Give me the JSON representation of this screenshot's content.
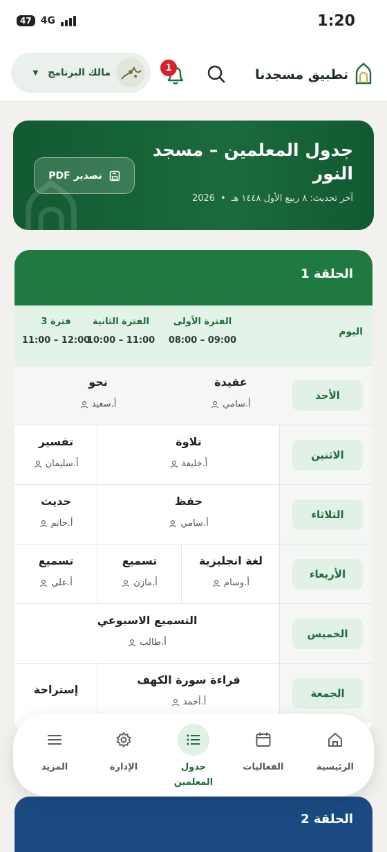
{
  "status_bar": {
    "battery": "47",
    "network": "4G",
    "time": "1:20"
  },
  "app_bar": {
    "app_name": "تطبيق مسجدنا",
    "notification_count": "1",
    "user_name": "مالك البرنامج",
    "icons": [
      "mosque-logo-icon",
      "search-icon",
      "bell-icon",
      "avatar",
      "caret-down-icon"
    ]
  },
  "hero": {
    "title": "جدول المعلمين – مسجد النور",
    "year": "2026",
    "dot": "•",
    "updated": "آخر تحديث: ٨ ربيع الأول ١٤٤٨ هـ",
    "export_label": "تصدير PDF",
    "colors": {
      "bg": "#1b6a3d"
    }
  },
  "circle1": {
    "title": "الحلقة 1",
    "header": {
      "day_label": "اليوم",
      "periods": [
        {
          "name": "الفترة الأولى",
          "time": "08:00 – 09:00"
        },
        {
          "name": "الفترة الثانية",
          "time": "10:00 – 11:00"
        },
        {
          "name": "فترة 3",
          "time": "11:00 – 12:00"
        }
      ]
    },
    "rows": [
      {
        "day": "الأحد",
        "slots": [
          {
            "subject": "عقيدة",
            "teacher": "أ.سامي"
          },
          {
            "subject": "نحو",
            "teacher": "أ.سعيد"
          }
        ]
      },
      {
        "day": "الاثنين",
        "slots": [
          {
            "subject": "تلاوة",
            "teacher": "أ.خليفة"
          },
          {
            "subject": "تفسير",
            "teacher": "أ.سليمان"
          }
        ]
      },
      {
        "day": "الثلاثاء",
        "slots": [
          {
            "subject": "حفظ",
            "teacher": "أ.سامي"
          },
          {
            "subject": "حديث",
            "teacher": "أ.حاتم"
          }
        ]
      },
      {
        "day": "الأربعاء",
        "slots": [
          {
            "subject": "لغة انجليزية",
            "teacher": "أ.وسام"
          },
          {
            "subject": "تسميع",
            "teacher": "أ.مازن"
          },
          {
            "subject": "تسميع",
            "teacher": "أ.علي"
          }
        ]
      },
      {
        "day": "الخميس",
        "slots": [
          {
            "subject": "التسميع الاسبوعي",
            "teacher": "أ.طالب"
          }
        ]
      },
      {
        "day": "الجمعة",
        "slots": [
          {
            "subject": "قراءة سورة الكهف",
            "teacher": "أ.أحمد"
          },
          {
            "subject": "إستراحة",
            "teacher": ""
          }
        ]
      }
    ]
  },
  "circle2": {
    "title": "الحلقة 2",
    "color": "#1b4a82"
  },
  "bottom_nav": {
    "items": [
      {
        "label": "الرئيسية",
        "icon": "home-icon"
      },
      {
        "label": "الفعاليات",
        "icon": "calendar-icon"
      },
      {
        "label": "جدول المعلمين",
        "icon": "list-icon",
        "active": true
      },
      {
        "label": "الإدارة",
        "icon": "gear-icon"
      },
      {
        "label": "المزيد",
        "icon": "menu-icon"
      }
    ]
  }
}
